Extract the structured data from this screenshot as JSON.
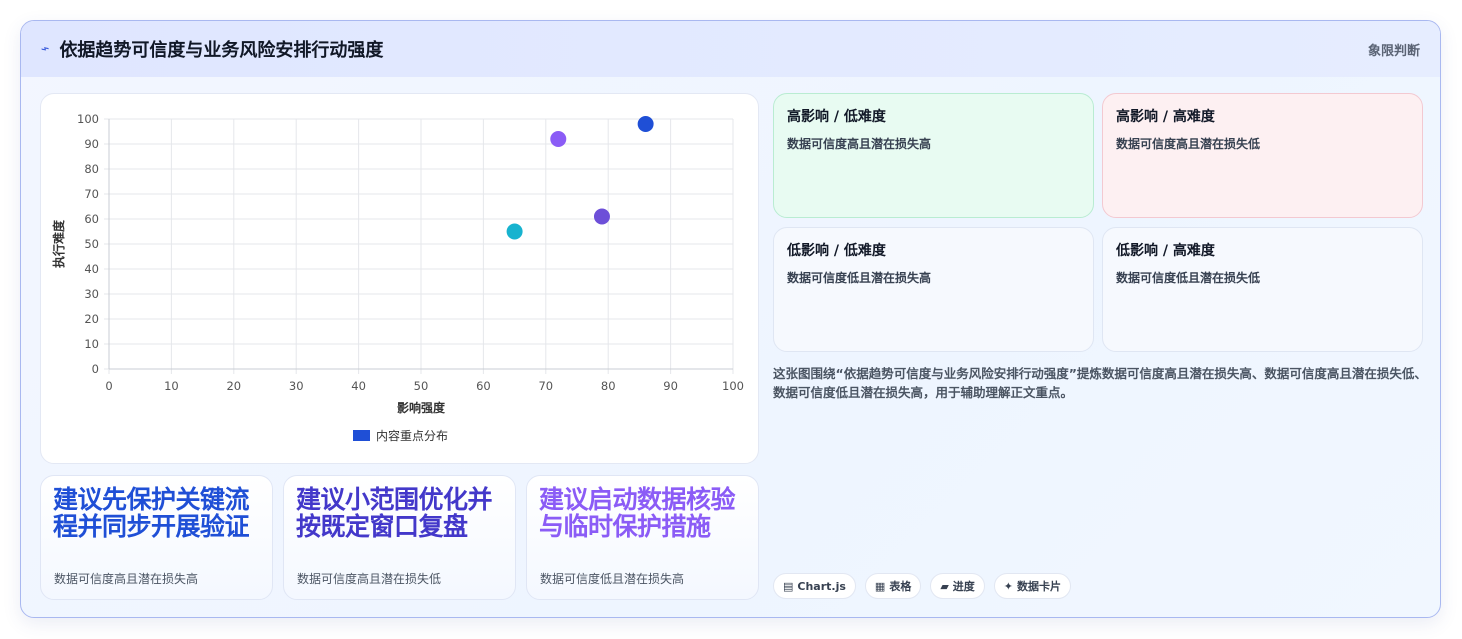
{
  "header": {
    "icon": "lightning-icon",
    "title": "依据趋势可信度与业务风险安排行动强度",
    "tag": "象限判断"
  },
  "colors": {
    "accent": "#1f4fd6",
    "purple": "#8b5cf6",
    "cyan": "#17b3cf",
    "indigo": "#4f46e5"
  },
  "chart_data": {
    "type": "scatter",
    "xlabel": "影响强度",
    "ylabel": "执行难度",
    "xlim": [
      0,
      100
    ],
    "ylim": [
      0,
      100
    ],
    "xticks": [
      "0",
      "10",
      "20",
      "30",
      "40",
      "50",
      "60",
      "70",
      "80",
      "90",
      "100"
    ],
    "yticks": [
      "0",
      "10",
      "20",
      "30",
      "40",
      "50",
      "60",
      "70",
      "80",
      "90",
      "100"
    ],
    "grid": true,
    "legend_position": "bottom",
    "series": [
      {
        "name": "内容重点分布",
        "color": "#1f4fd6",
        "points": [
          {
            "x": 86,
            "y": 98,
            "color": "#1f4fd6"
          },
          {
            "x": 72,
            "y": 92,
            "color": "#8b5cf6"
          },
          {
            "x": 79,
            "y": 61,
            "color": "#6d4fd8"
          },
          {
            "x": 65,
            "y": 55,
            "color": "#17b3cf"
          }
        ]
      }
    ]
  },
  "recommendations": [
    {
      "title": "建议先保护关键流程并同步开展验证",
      "sub": "数据可信度高且潜在损失高",
      "color": "#1f4fd6"
    },
    {
      "title": "建议小范围优化并按既定窗口复盘",
      "sub": "数据可信度高且潜在损失低",
      "color": "#4338ca"
    },
    {
      "title": "建议启动数据核验与临时保护措施",
      "sub": "数据可信度低且潜在损失高",
      "color": "#8b5cf6"
    }
  ],
  "quadrants": [
    {
      "title": "高影响 / 低难度",
      "desc": "数据可信度高且潜在损失高"
    },
    {
      "title": "高影响 / 高难度",
      "desc": "数据可信度高且潜在损失低"
    },
    {
      "title": "低影响 / 低难度",
      "desc": "数据可信度低且潜在损失高"
    },
    {
      "title": "低影响 / 高难度",
      "desc": "数据可信度低且潜在损失低"
    }
  ],
  "description": "这张图围绕“依据趋势可信度与业务风险安排行动强度”提炼数据可信度高且潜在损失高、数据可信度高且潜在损失低、数据可信度低且潜在损失高，用于辅助理解正文重点。",
  "badges": [
    {
      "icon": "chart-icon",
      "glyph": "▤",
      "label": "Chart.js"
    },
    {
      "icon": "table-icon",
      "glyph": "▦",
      "label": "表格"
    },
    {
      "icon": "progress-icon",
      "glyph": "▰",
      "label": "进度"
    },
    {
      "icon": "sparkle-icon",
      "glyph": "✦",
      "label": "数据卡片"
    }
  ]
}
